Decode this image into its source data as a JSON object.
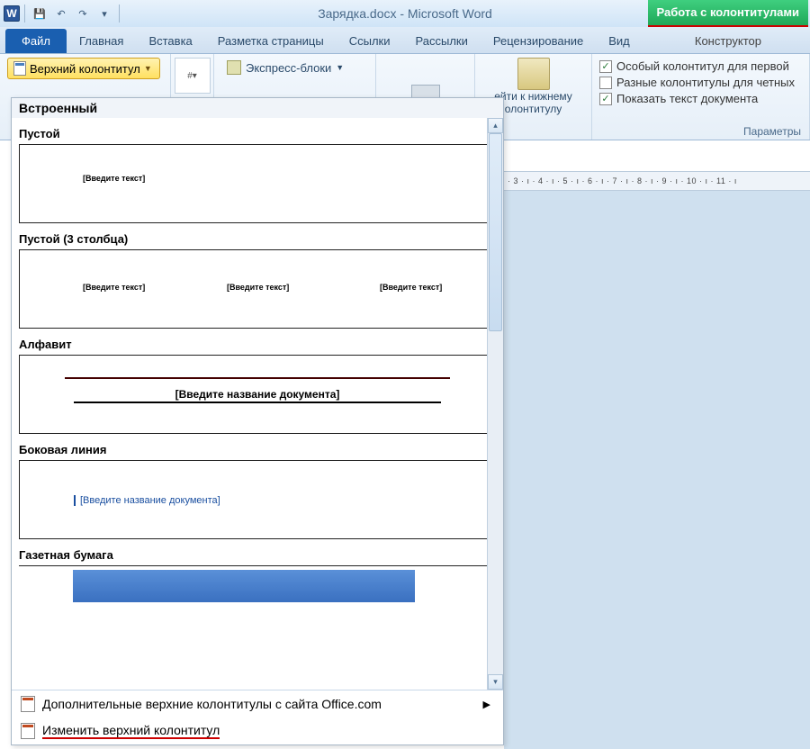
{
  "title": "Зарядка.docx - Microsoft Word",
  "tools_tab": "Работа с колонтитулами",
  "tabs": {
    "file": "Файл",
    "home": "Главная",
    "insert": "Вставка",
    "layout": "Разметка страницы",
    "refs": "Ссылки",
    "mail": "Рассылки",
    "review": "Рецензирование",
    "view": "Вид",
    "design": "Конструктор"
  },
  "ribbon": {
    "header_btn": "Верхний колонтитул",
    "express": "Экспресс-блоки",
    "go_footer_1": "ейти к нижнему",
    "go_footer_2": "олонтитулу",
    "chk1": "Особый колонтитул для первой",
    "chk2": "Разные колонтитулы для четных",
    "chk3": "Показать текст документа",
    "group_params": "Параметры"
  },
  "gallery": {
    "builtin": "Встроенный",
    "empty": "Пустой",
    "empty3": "Пустой (3 столбца)",
    "alpha": "Алфавит",
    "side": "Боковая линия",
    "news": "Газетная бумага",
    "ph_text": "[Введите текст]",
    "ph_title": "[Введите название документа]",
    "foot_more": "Дополнительные верхние колонтитулы с сайта Office.com",
    "foot_edit": "Изменить верхний колонтитул"
  },
  "ruler": "· 3 · ı · 4 · ı · 5 · ı · 6 · ı · 7 · ı · 8 · ı · 9 · ı · 10 · ı · 11 · ı"
}
